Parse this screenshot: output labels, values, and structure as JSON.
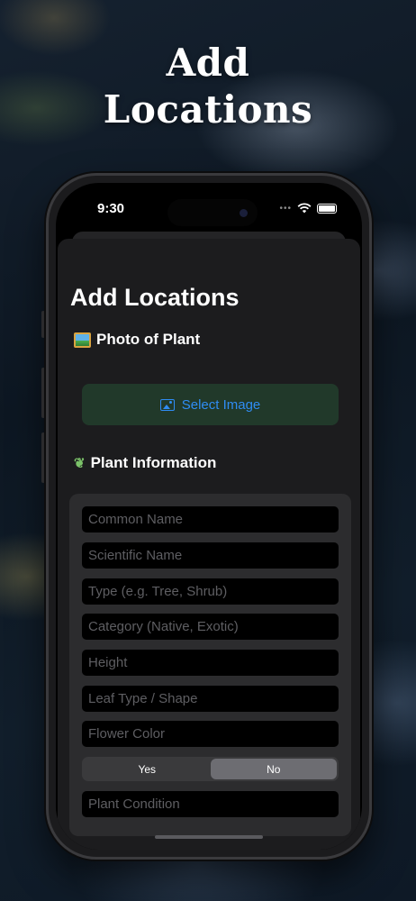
{
  "hero": {
    "title_line1": "Add",
    "title_line2": "Locations"
  },
  "status_bar": {
    "time": "9:30",
    "dots": "•••"
  },
  "screen": {
    "title": "Add Locations",
    "photo_section": {
      "icon": "framed-picture-emoji",
      "label": "Photo of Plant"
    },
    "select_image_button": {
      "icon": "photo-icon",
      "label": "Select Image"
    },
    "plant_section": {
      "icon": "leaf-emoji",
      "label": "Plant Information"
    },
    "fields": [
      {
        "placeholder": "Common Name"
      },
      {
        "placeholder": "Scientific Name"
      },
      {
        "placeholder": "Type (e.g. Tree, Shrub)"
      },
      {
        "placeholder": "Category (Native, Exotic)"
      },
      {
        "placeholder": "Height"
      },
      {
        "placeholder": "Leaf Type / Shape"
      },
      {
        "placeholder": "Flower Color"
      }
    ],
    "segmented": {
      "options": [
        "Yes",
        "No"
      ],
      "selected": "No"
    },
    "condition_field": {
      "placeholder": "Plant Condition"
    }
  },
  "colors": {
    "accent": "#2f8cf3",
    "select_button_bg": "#21392a",
    "sheet_bg": "#1c1c1e",
    "card_bg": "#2c2c2e"
  }
}
